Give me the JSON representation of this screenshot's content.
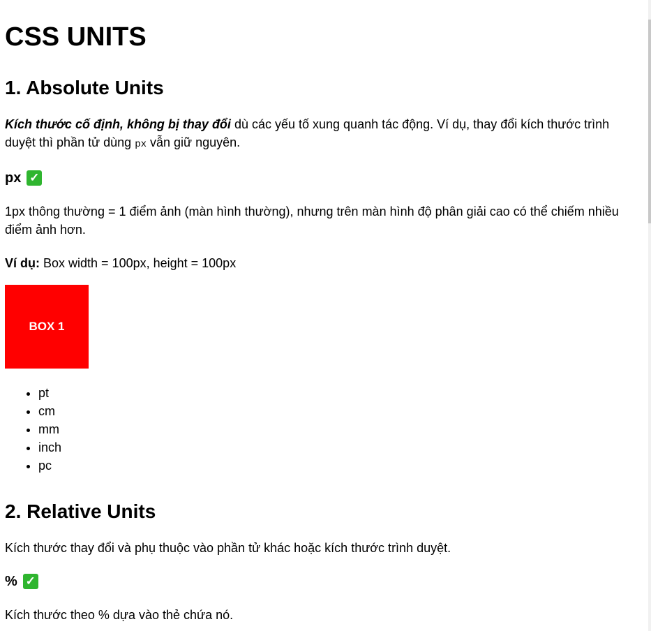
{
  "title": "CSS UNITS",
  "section1": {
    "heading": "1. Absolute Units",
    "intro_em": "Kích thước cố định, không bị thay đổi",
    "intro_rest_a": " dù các yếu tố xung quanh tác động. Ví dụ, thay đổi kích thước trình duyệt thì phần tử dùng ",
    "intro_code": "px",
    "intro_rest_b": " vẫn giữ nguyên.",
    "px": {
      "heading": "px",
      "check_icon": "check-mark-icon",
      "desc": "1px thông thường = 1 điểm ảnh (màn hình thường), nhưng trên màn hình độ phân giải cao có thể chiếm nhiều điểm ảnh hơn.",
      "example_label": "Ví dụ:",
      "example_text": " Box width = 100px, height = 100px",
      "box_label": "BOX 1",
      "box_color": "#ff0000"
    },
    "units": [
      "pt",
      "cm",
      "mm",
      "inch",
      "pc"
    ]
  },
  "section2": {
    "heading": "2. Relative Units",
    "intro": "Kích thước thay đổi và phụ thuộc vào phần tử khác hoặc kích thước trình duyệt.",
    "percent": {
      "heading": "%",
      "check_icon": "check-mark-icon",
      "desc": "Kích thước theo % dựa vào thẻ chứa nó."
    }
  },
  "colors": {
    "check_bg": "#2fb52f"
  }
}
